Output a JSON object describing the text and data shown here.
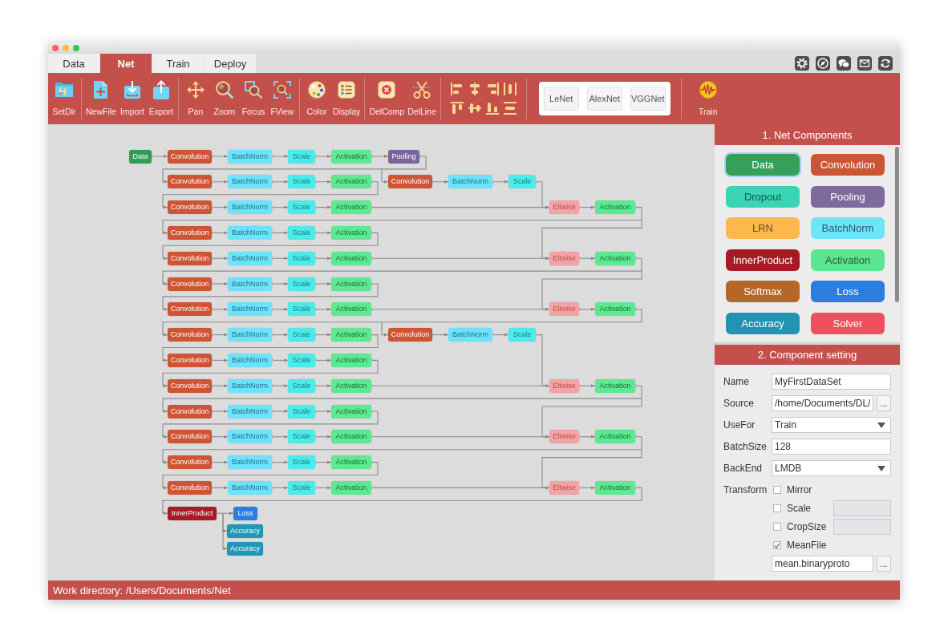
{
  "window": {
    "tabs": [
      {
        "label": "Data",
        "selected": false
      },
      {
        "label": "Net",
        "selected": true
      },
      {
        "label": "Train",
        "selected": false
      },
      {
        "label": "Deploy",
        "selected": false
      }
    ]
  },
  "toolbar": {
    "groups": [
      [
        "SetDir"
      ],
      [
        "NewFile",
        "Import",
        "Export"
      ],
      [
        "Pan",
        "Zoom",
        "Focus",
        "FView"
      ],
      [
        "Color",
        "Display"
      ],
      [
        "DelComp",
        "DelLine"
      ]
    ],
    "presets": [
      "LeNet",
      "AlexNet",
      "VGGNet"
    ],
    "train": "Train"
  },
  "network": {
    "rows": [
      {
        "nodes": [
          {
            "label": "Data",
            "kind": "data"
          },
          {
            "label": "Convolution",
            "kind": "convolution"
          },
          {
            "label": "BatchNorm",
            "kind": "batchnorm"
          },
          {
            "label": "Scale",
            "kind": "scale"
          },
          {
            "label": "Activation",
            "kind": "activation"
          },
          {
            "label": "Pooling",
            "kind": "pooling"
          }
        ]
      },
      {
        "nodes": [
          {
            "label": "Convolution",
            "kind": "convolution"
          },
          {
            "label": "BatchNorm",
            "kind": "batchnorm"
          },
          {
            "label": "Scale",
            "kind": "scale"
          },
          {
            "label": "Activation",
            "kind": "activation"
          }
        ],
        "branch": [
          {
            "label": "Convolution",
            "kind": "convolution"
          },
          {
            "label": "BatchNorm",
            "kind": "batchnorm"
          },
          {
            "label": "Scale",
            "kind": "scale"
          }
        ]
      },
      {
        "nodes": [
          {
            "label": "Convolution",
            "kind": "convolution"
          },
          {
            "label": "BatchNorm",
            "kind": "batchnorm"
          },
          {
            "label": "Scale",
            "kind": "scale"
          },
          {
            "label": "Activation",
            "kind": "activation"
          }
        ],
        "branch": [
          {
            "label": "Eltwise",
            "kind": "eltwise"
          },
          {
            "label": "Activation",
            "kind": "activation"
          }
        ]
      },
      {
        "nodes": [
          {
            "label": "Convolution",
            "kind": "convolution"
          },
          {
            "label": "BatchNorm",
            "kind": "batchnorm"
          },
          {
            "label": "Scale",
            "kind": "scale"
          },
          {
            "label": "Activation",
            "kind": "activation"
          }
        ]
      },
      {
        "nodes": [
          {
            "label": "Convolution",
            "kind": "convolution"
          },
          {
            "label": "BatchNorm",
            "kind": "batchnorm"
          },
          {
            "label": "Scale",
            "kind": "scale"
          },
          {
            "label": "Activation",
            "kind": "activation"
          }
        ],
        "branch": [
          {
            "label": "Eltwise",
            "kind": "eltwise"
          },
          {
            "label": "Activation",
            "kind": "activation"
          }
        ]
      },
      {
        "nodes": [
          {
            "label": "Convolution",
            "kind": "convolution"
          },
          {
            "label": "BatchNorm",
            "kind": "batchnorm"
          },
          {
            "label": "Scale",
            "kind": "scale"
          },
          {
            "label": "Activation",
            "kind": "activation"
          }
        ]
      },
      {
        "nodes": [
          {
            "label": "Convolution",
            "kind": "convolution"
          },
          {
            "label": "BatchNorm",
            "kind": "batchnorm"
          },
          {
            "label": "Scale",
            "kind": "scale"
          },
          {
            "label": "Activation",
            "kind": "activation"
          }
        ],
        "branch": [
          {
            "label": "Eltwise",
            "kind": "eltwise"
          },
          {
            "label": "Activation",
            "kind": "activation"
          }
        ]
      },
      {
        "nodes": [
          {
            "label": "Convolution",
            "kind": "convolution"
          },
          {
            "label": "BatchNorm",
            "kind": "batchnorm"
          },
          {
            "label": "Scale",
            "kind": "scale"
          },
          {
            "label": "Activation",
            "kind": "activation"
          }
        ],
        "branch": [
          {
            "label": "Convolution",
            "kind": "convolution"
          },
          {
            "label": "BatchNorm",
            "kind": "batchnorm"
          },
          {
            "label": "Scale",
            "kind": "scale"
          }
        ]
      },
      {
        "nodes": [
          {
            "label": "Convolution",
            "kind": "convolution"
          },
          {
            "label": "BatchNorm",
            "kind": "batchnorm"
          },
          {
            "label": "Scale",
            "kind": "scale"
          },
          {
            "label": "Activation",
            "kind": "activation"
          }
        ]
      },
      {
        "nodes": [
          {
            "label": "Convolution",
            "kind": "convolution"
          },
          {
            "label": "BatchNorm",
            "kind": "batchnorm"
          },
          {
            "label": "Scale",
            "kind": "scale"
          },
          {
            "label": "Activation",
            "kind": "activation"
          }
        ],
        "branch": [
          {
            "label": "Eltwise",
            "kind": "eltwise"
          },
          {
            "label": "Activation",
            "kind": "activation"
          }
        ]
      },
      {
        "nodes": [
          {
            "label": "Convolution",
            "kind": "convolution"
          },
          {
            "label": "BatchNorm",
            "kind": "batchnorm"
          },
          {
            "label": "Scale",
            "kind": "scale"
          },
          {
            "label": "Activation",
            "kind": "activation"
          }
        ]
      },
      {
        "nodes": [
          {
            "label": "Convolution",
            "kind": "convolution"
          },
          {
            "label": "BatchNorm",
            "kind": "batchnorm"
          },
          {
            "label": "Scale",
            "kind": "scale"
          },
          {
            "label": "Activation",
            "kind": "activation"
          }
        ],
        "branch": [
          {
            "label": "Eltwise",
            "kind": "eltwise"
          },
          {
            "label": "Activation",
            "kind": "activation"
          }
        ]
      },
      {
        "nodes": [
          {
            "label": "Convolution",
            "kind": "convolution"
          },
          {
            "label": "BatchNorm",
            "kind": "batchnorm"
          },
          {
            "label": "Scale",
            "kind": "scale"
          },
          {
            "label": "Activation",
            "kind": "activation"
          }
        ]
      },
      {
        "nodes": [
          {
            "label": "Convolution",
            "kind": "convolution"
          },
          {
            "label": "BatchNorm",
            "kind": "batchnorm"
          },
          {
            "label": "Scale",
            "kind": "scale"
          },
          {
            "label": "Activation",
            "kind": "activation"
          }
        ],
        "branch": [
          {
            "label": "Eltwise",
            "kind": "eltwise"
          },
          {
            "label": "Activation",
            "kind": "activation"
          }
        ]
      }
    ],
    "head": {
      "node": {
        "label": "InnerProduct",
        "kind": "innerproduct"
      },
      "outputs": [
        {
          "label": "Loss",
          "kind": "loss"
        },
        {
          "label": "Accuracy",
          "kind": "accuracy"
        },
        {
          "label": "Accuracy",
          "kind": "accuracy"
        }
      ]
    }
  },
  "components": {
    "title": "1. Net Components",
    "items": [
      {
        "label": "Data",
        "color": "#35a05a",
        "selected": true
      },
      {
        "label": "Convolution",
        "color": "#cc5535",
        "selected": false
      },
      {
        "label": "Dropout",
        "color": "#3ad4b4",
        "selected": false
      },
      {
        "label": "Pooling",
        "color": "#7e6a9c",
        "selected": false
      },
      {
        "label": "LRN",
        "color": "#ffb84d",
        "selected": false
      },
      {
        "label": "BatchNorm",
        "color": "#6ee4fb",
        "selected": false
      },
      {
        "label": "InnerProduct",
        "color": "#a51a25",
        "selected": false
      },
      {
        "label": "Activation",
        "color": "#5ce690",
        "selected": false
      },
      {
        "label": "Softmax",
        "color": "#b5672a",
        "selected": false
      },
      {
        "label": "Loss",
        "color": "#2b7de0",
        "selected": false
      },
      {
        "label": "Accuracy",
        "color": "#2393b3",
        "selected": false
      },
      {
        "label": "Solver",
        "color": "#ef5060",
        "selected": false
      }
    ]
  },
  "settings": {
    "title": "2. Component setting",
    "fields": [
      {
        "kind": "text",
        "label": "Name",
        "value": "MyFirstDataSet"
      },
      {
        "kind": "file",
        "label": "Source",
        "value": "/home/Documents/DL/",
        "button": "..."
      },
      {
        "kind": "select",
        "label": "UseFor",
        "value": "Train"
      },
      {
        "kind": "text",
        "label": "BatchSize",
        "value": "128"
      },
      {
        "kind": "select",
        "label": "BackEnd",
        "value": "LMDB"
      }
    ],
    "transform": {
      "label": "Transform",
      "options": [
        {
          "kind": "plain",
          "label": "Mirror",
          "checked": false
        },
        {
          "kind": "input",
          "label": "Scale",
          "checked": false
        },
        {
          "kind": "input",
          "label": "CropSize",
          "checked": false
        },
        {
          "kind": "file",
          "label": "MeanFile",
          "checked": true,
          "value": "mean.binaryproto",
          "button": "..."
        }
      ]
    }
  },
  "status_bar": {
    "text": "Work directory: /Users/Documents/Net"
  }
}
